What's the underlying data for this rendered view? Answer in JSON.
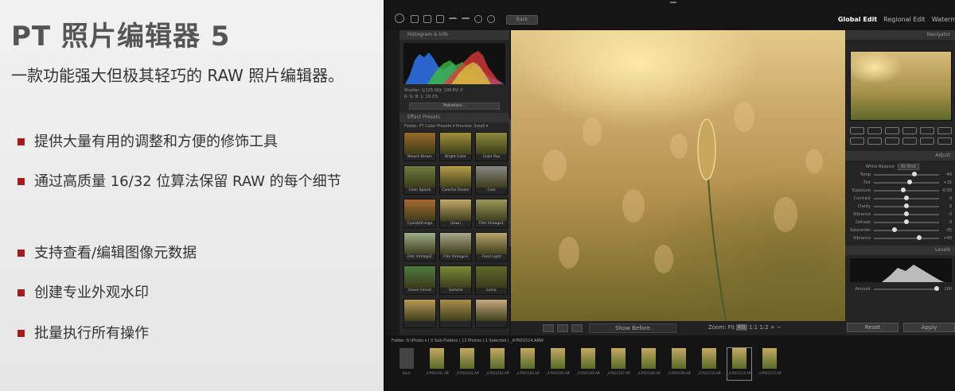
{
  "promo": {
    "title": "PT 照片编辑器 5",
    "subtitle": "一款功能强大但极其轻巧的 RAW 照片编辑器。",
    "features": [
      "提供大量有用的调整和方便的修饰工具",
      "通过高质量 16/32 位算法保留 RAW 的每个细节",
      "支持查看/编辑图像元数据",
      "创建专业外观水印",
      "批量执行所有操作"
    ],
    "bullet_color": "#a11c1c"
  },
  "app": {
    "back_label": "Back",
    "tabs": [
      "Global Edit",
      "Regional Edit",
      "Waterm"
    ],
    "left_panel": {
      "histogram_title": "Histogram & Info",
      "info_line1": "Shutter: 1/125 ISO: 100 EV: 0",
      "info_line2": "R:   G:   B:   L: 10.2%",
      "metadata_button": "Metadata...",
      "presets_title": "Effect Presets",
      "folder_line": "Folder: PT Color Presets ▾   Preview: Small ▾",
      "presets": [
        {
          "label": "Bleach Brown",
          "tone": "#9b6a2c"
        },
        {
          "label": "Bright Color",
          "tone": "#a09238"
        },
        {
          "label": "Color Pop",
          "tone": "#8b8a3a"
        },
        {
          "label": "Color Splash",
          "tone": "#6d7a40"
        },
        {
          "label": "Colorful Dream",
          "tone": "#b79d4a"
        },
        {
          "label": "Cool",
          "tone": "#8a8784"
        },
        {
          "label": "Cyan&Orange",
          "tone": "#a86a30"
        },
        {
          "label": "Dawn",
          "tone": "#c4aa6a"
        },
        {
          "label": "Film Vintage1",
          "tone": "#9a9a5a"
        },
        {
          "label": "Film Vintage2",
          "tone": "#9fae8a"
        },
        {
          "label": "Film Vintage3",
          "tone": "#a7a98a"
        },
        {
          "label": "Front Light",
          "tone": "#b9a36a"
        },
        {
          "label": "Green Forest",
          "tone": "#4f7a40"
        },
        {
          "label": "Gamma",
          "tone": "#7a8a3a"
        },
        {
          "label": "Lomo",
          "tone": "#5f6a2a"
        },
        {
          "label": "",
          "tone": "#b99a5a"
        },
        {
          "label": "",
          "tone": "#a88f4a"
        },
        {
          "label": "",
          "tone": "#c4aa7a"
        }
      ]
    },
    "viewer": {
      "show_before": "Show Before",
      "zoom_label": "Zoom:",
      "zoom_fit": "Fit",
      "zoom_fill": "Fill",
      "zoom_ratio": "1:1",
      "zoom_custom": "1:2"
    },
    "right_panel": {
      "navigator_title": "Navigator",
      "adjust_title": "Adjust",
      "white_balance_label": "White Balance",
      "white_balance_value": "As Shot",
      "sliders": [
        {
          "label": "Temp",
          "value": "-46",
          "pos": 0.62
        },
        {
          "label": "Tint",
          "value": "+15",
          "pos": 0.55
        },
        {
          "label": "Exposure",
          "value": "-0.50",
          "pos": 0.45
        },
        {
          "label": "Contrast",
          "value": "0",
          "pos": 0.5
        },
        {
          "label": "Clarity",
          "value": "0",
          "pos": 0.5
        },
        {
          "label": "Vibrance",
          "value": "0",
          "pos": 0.5
        },
        {
          "label": "Dehaze",
          "value": "0",
          "pos": 0.5
        },
        {
          "label": "Saturation",
          "value": "-35",
          "pos": 0.32
        },
        {
          "label": "Vibrance",
          "value": "+40",
          "pos": 0.7
        }
      ],
      "levels_title": "Levels",
      "amount_label": "Amount",
      "amount_value": "100",
      "reset_label": "Reset",
      "apply_label": "Apply"
    },
    "filmstrip": {
      "path": "Folder: D:\\Photo ▾  | 0 Sub-Folders | 12 Photos | 1 Selected | _A7R01514.ARW",
      "items": [
        "Back",
        "_A7R01501.ARW",
        "_A7R01502.ARW",
        "_A7R01503.ARW",
        "_A7R01504.ARW",
        "_A7R01505.ARW",
        "_A7R01506.ARW",
        "_A7R01507.ARW",
        "_A7R01508.ARW",
        "_A7R01509.ARW",
        "_A7R01510.ARW",
        "_A7R01514.ARW",
        "_A7R01515.ARW"
      ]
    }
  }
}
